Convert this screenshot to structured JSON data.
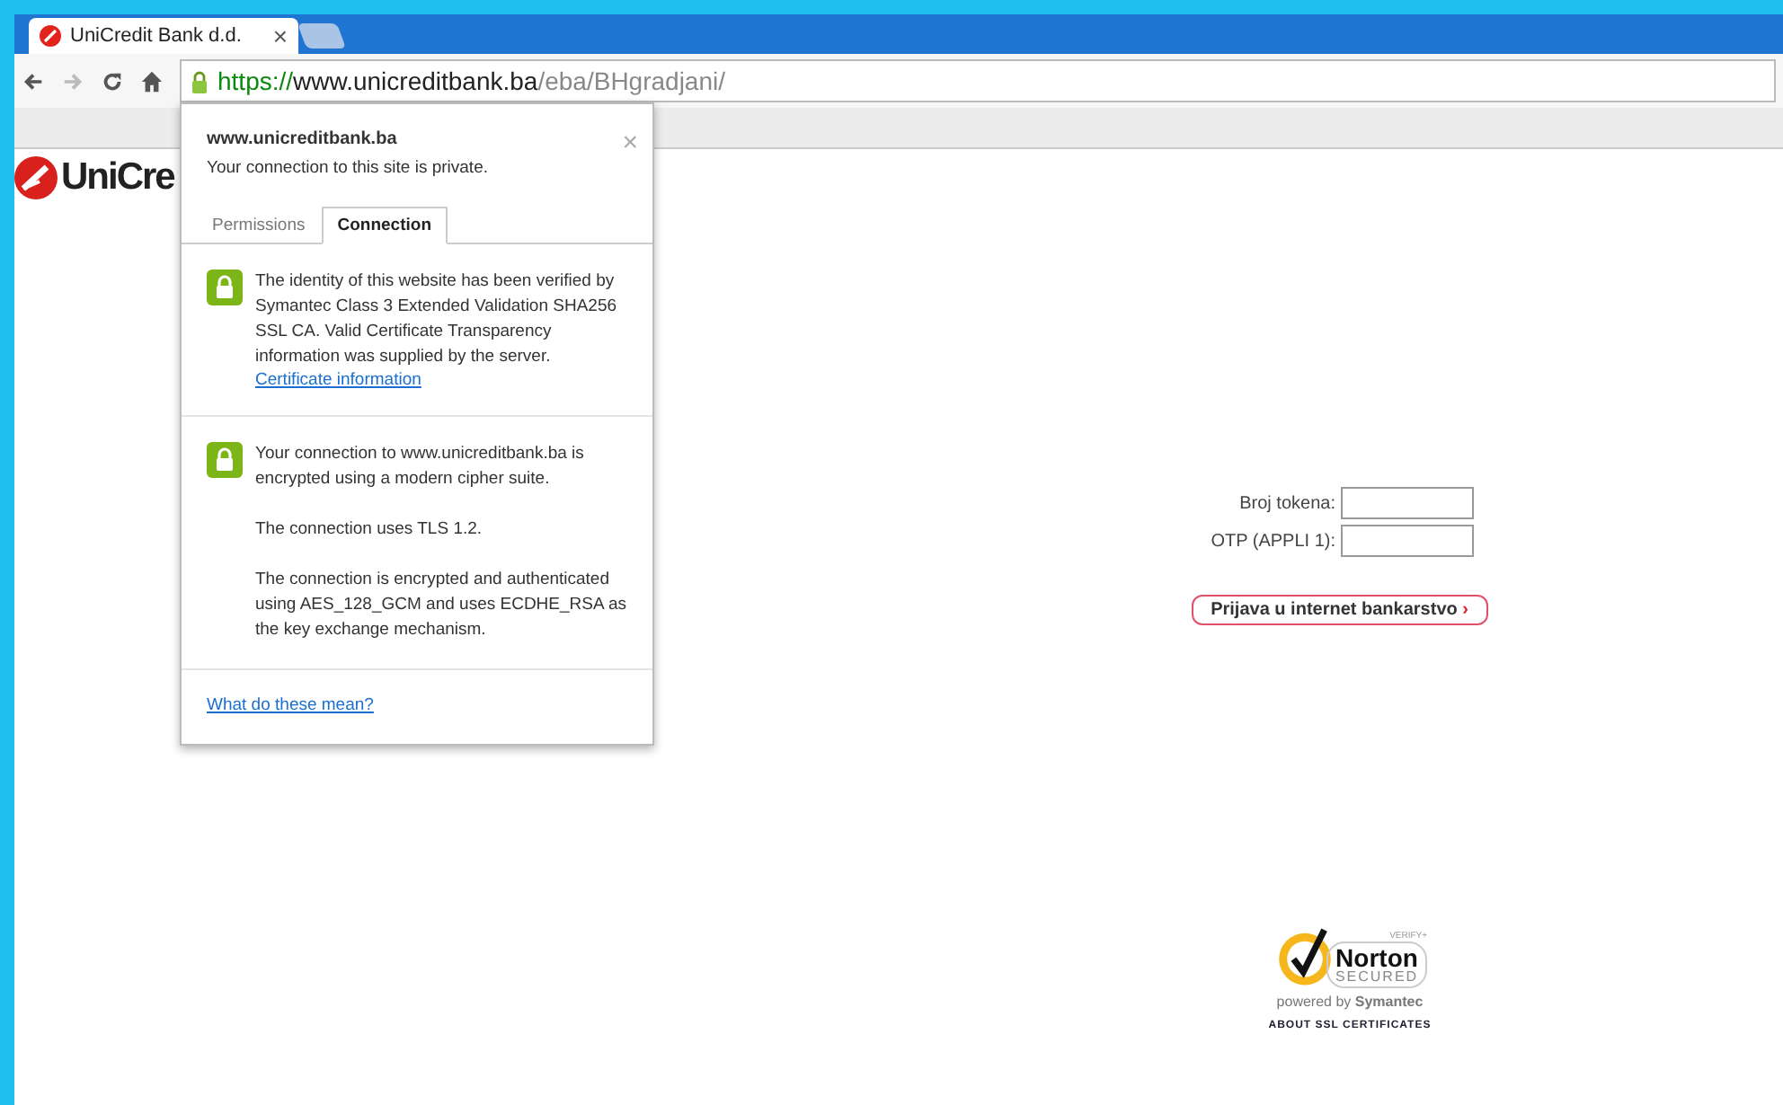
{
  "browser": {
    "tabs": [
      {
        "title": "UniCredit Bank d.d.",
        "close": "×",
        "selected": true
      },
      {
        "selected": false
      }
    ],
    "address": {
      "scheme": "https://",
      "host": "www.unicreditbank.ba",
      "path": "/eba/BHgradjani/"
    }
  },
  "popup": {
    "site": "www.unicreditbank.ba",
    "subtitle": "Your connection to this site is private.",
    "close": "×",
    "tabs": [
      {
        "label": "Permissions",
        "selected": false
      },
      {
        "label": "Connection",
        "selected": true
      }
    ],
    "sections": [
      {
        "paragraphs": [
          "The identity of this website has been verified by Symantec Class 3 Extended Validation SHA256 SSL CA. Valid Certificate Transparency information was supplied by the server."
        ],
        "link": "Certificate information"
      },
      {
        "paragraphs": [
          "Your connection to www.unicreditbank.ba is encrypted using a modern cipher suite.",
          "The connection uses TLS 1.2.",
          "The connection is encrypted and authenticated using AES_128_GCM and uses ECDHE_RSA as the key exchange mechanism."
        ]
      }
    ],
    "footer_link": "What do these mean?"
  },
  "page": {
    "logo_text": "UniCre",
    "login": {
      "fields": [
        {
          "label": "Broj tokena:"
        },
        {
          "label": "OTP (APPLI 1):"
        }
      ],
      "button": "Prijava u internet bankarstvo",
      "button_arrow": "›"
    },
    "seal": {
      "verify": "VERIFY+",
      "brand": "Norton",
      "secured": "SECURED",
      "powered": "powered by **Symantec**",
      "about": "ABOUT SSL CERTIFICATES"
    }
  }
}
